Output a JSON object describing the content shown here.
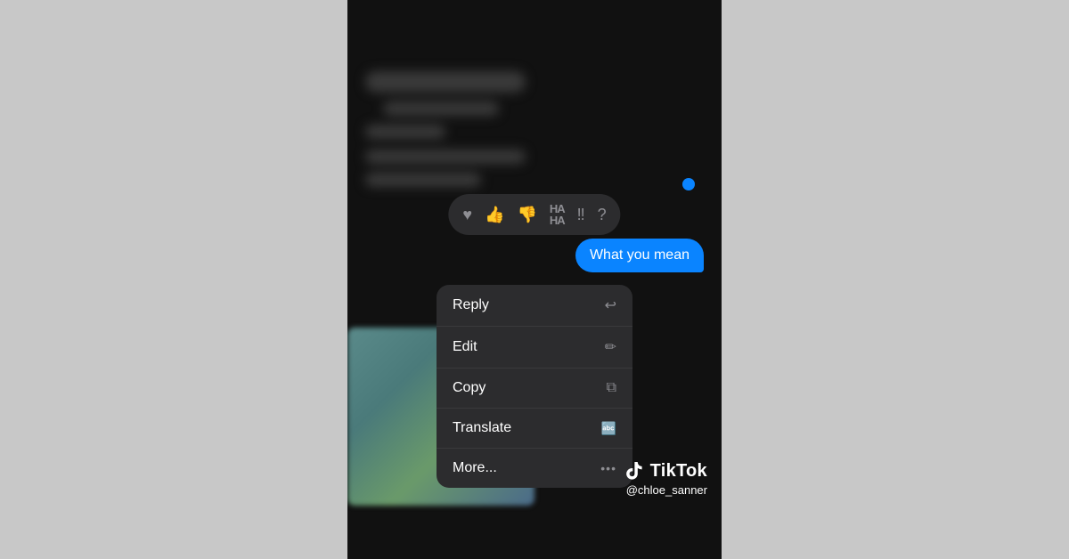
{
  "phone": {
    "background_color": "#111"
  },
  "reaction_bar": {
    "icons": [
      "♥",
      "👍",
      "👎",
      "😂",
      "‼",
      "❓"
    ]
  },
  "message": {
    "text": "What you mean",
    "bubble_color": "#0a84ff"
  },
  "context_menu": {
    "items": [
      {
        "label": "Reply",
        "icon": "↩"
      },
      {
        "label": "Edit",
        "icon": "✏"
      },
      {
        "label": "Copy",
        "icon": "⧉"
      },
      {
        "label": "Translate",
        "icon": "🔤"
      },
      {
        "label": "More...",
        "icon": "···"
      }
    ]
  },
  "tiktok": {
    "handle": "@chloe_sanner",
    "brand_text": "TikTok"
  }
}
